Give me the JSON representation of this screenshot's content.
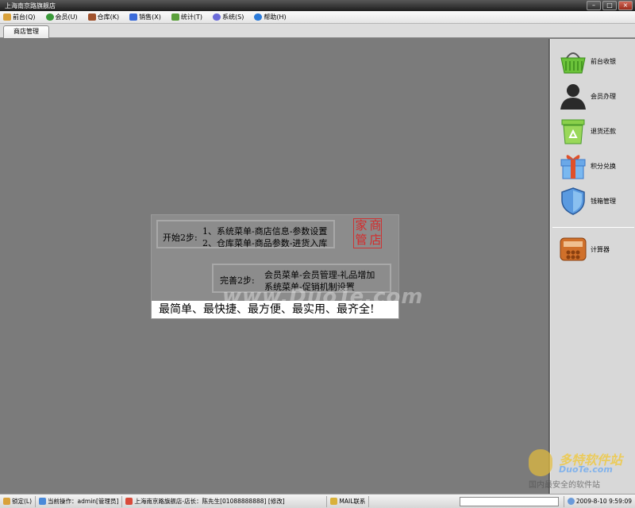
{
  "window": {
    "title": "上海南京路旗舰店",
    "min": "–",
    "max": "□",
    "close": "×"
  },
  "menu": [
    {
      "label": "前台(Q)",
      "color": "#d9a13a"
    },
    {
      "label": "会员(U)",
      "color": "#3a9a3a"
    },
    {
      "label": "仓库(K)",
      "color": "#a0522d"
    },
    {
      "label": "销售(X)",
      "color": "#3a6ad9"
    },
    {
      "label": "统计(T)",
      "color": "#5aa03a"
    },
    {
      "label": "系统(S)",
      "color": "#6a6ad9"
    },
    {
      "label": "帮助(H)",
      "color": "#2a7ad9"
    }
  ],
  "tab": {
    "label": "商店管理"
  },
  "panel": {
    "step1_label": "开始2步:",
    "step1_line1": "1、系统菜单-商店信息-参数设置",
    "step1_line2": "2、仓库菜单-商品参数-进货入库",
    "seal": [
      "商",
      "店",
      "管",
      "家"
    ],
    "step2_label": "完善2步:",
    "step2_line1": "会员菜单-会员管理-礼品增加",
    "step2_line2": "系统菜单-促销机制设置",
    "slogan": "最简单、最快捷、最方便、最实用、最齐全!"
  },
  "watermark": "www.DuoTe.com",
  "sidebar": [
    {
      "label": "前台收银",
      "icon": "basket-icon"
    },
    {
      "label": "会员办理",
      "icon": "member-icon"
    },
    {
      "label": "退货还款",
      "icon": "recycle-bin-icon"
    },
    {
      "label": "积分兑换",
      "icon": "gift-icon"
    },
    {
      "label": "钱箱管理",
      "icon": "shield-icon"
    },
    {
      "label": "计算器",
      "icon": "calculator-icon"
    }
  ],
  "brand": {
    "line1": "多特软件站",
    "line2": "DuoTe.com",
    "line3": "国内最安全的软件站"
  },
  "status": {
    "lock": "锁定(L)",
    "operator": "当前操作：admin[管理员]",
    "store": "上海南京路旗舰店-店长：陈先生[01088888888] [修改]",
    "mail": "MAIL联系",
    "datetime": "2009-8-10 9:59:09"
  }
}
